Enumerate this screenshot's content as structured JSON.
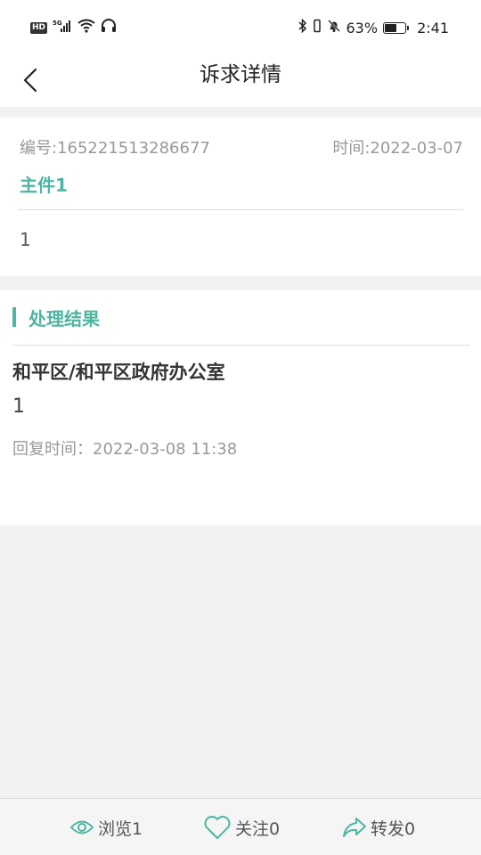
{
  "status_bar": {
    "hd": "HD",
    "network": "5G",
    "battery_percent": "63%",
    "battery_level": 0.63,
    "time": "2:41"
  },
  "nav": {
    "title": "诉求详情"
  },
  "info": {
    "number": "编号:165221513286677",
    "time": "时间:2022-03-07",
    "subject": "主件1",
    "content": "1"
  },
  "result": {
    "title": "处理结果",
    "department": "和平区/和平区政府办公室",
    "content": "1",
    "reply_time": "回复时间：2022-03-08 11:38"
  },
  "bottom": {
    "view_label": "浏览1",
    "follow_label": "关注0",
    "share_label": "转发0"
  },
  "colors": {
    "accent": "#4db6a2",
    "background": "#f2f2f2"
  }
}
